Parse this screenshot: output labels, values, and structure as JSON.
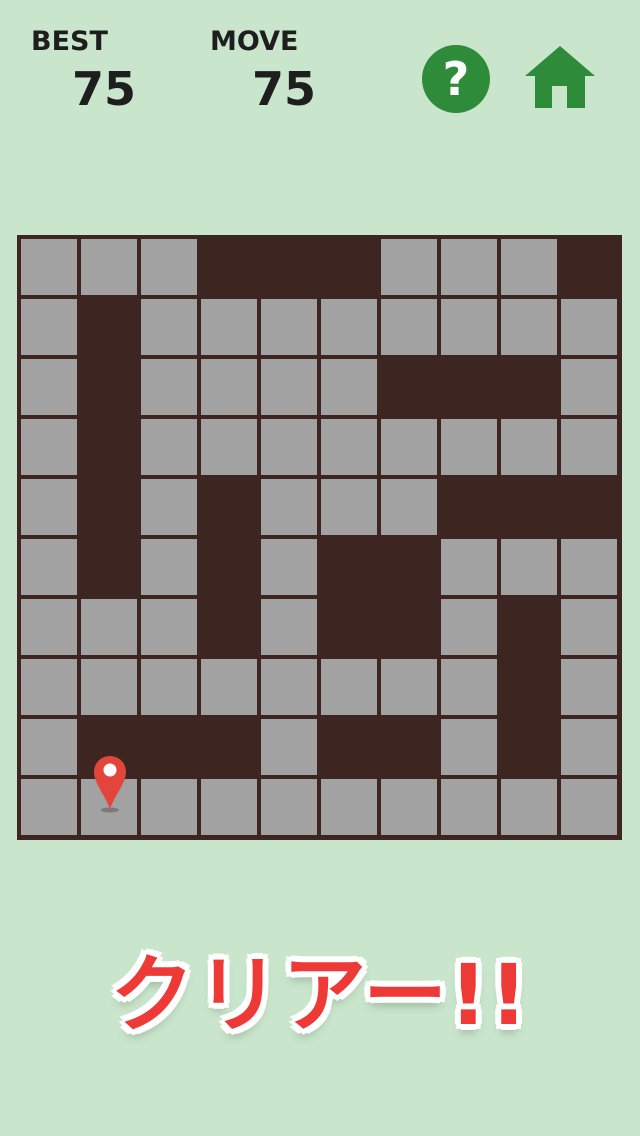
{
  "header": {
    "best_label": "BEST",
    "best_value": "75",
    "move_label": "MOVE",
    "move_value": "75",
    "help_symbol": "?",
    "help_icon": "question-icon",
    "home_icon": "home-icon"
  },
  "board": {
    "rows": 10,
    "cols": 10,
    "grid": [
      "GGG...GGG",
      "G.GGGGGGGG",
      "G.GGGG...G",
      "G.GGGGGGGG",
      "G.G.GGG...",
      "G.G.G..GGG",
      "GGG.G..G.G",
      "GGGGGGGG.G",
      "G...G..G.G",
      "GGGGGGGGGG"
    ],
    "player_cell": [
      9,
      1
    ],
    "player_icon": "map-pin-icon",
    "colors": {
      "background": "#c9e6cc",
      "wall": "#3d2522",
      "tile": "#a2a2a2",
      "accent_green": "#2e8b3a",
      "pin_red": "#e2463a"
    }
  },
  "message": {
    "text": "クリアー!!",
    "color": "#ee3a36"
  }
}
